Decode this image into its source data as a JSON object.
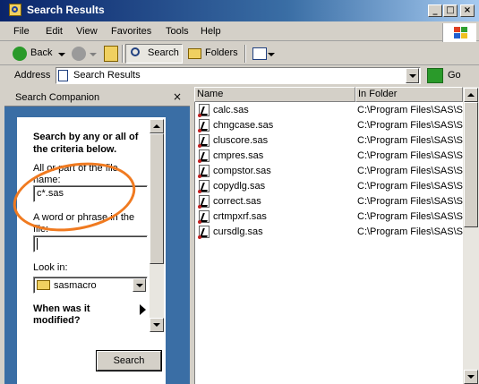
{
  "window": {
    "title": "Search Results",
    "controls": [
      "_",
      "□",
      "×"
    ]
  },
  "menubar": {
    "items": [
      "File",
      "Edit",
      "View",
      "Favorites",
      "Tools",
      "Help"
    ]
  },
  "toolbar": {
    "back_label": "Back",
    "search_label": "Search",
    "folders_label": "Folders"
  },
  "address_bar": {
    "label": "Address",
    "value": "Search Results",
    "go_label": "Go"
  },
  "search_companion": {
    "title": "Search Companion",
    "heading": "Search by any or all of the criteria below.",
    "filename_label": "All or part of the file name:",
    "filename_value": "c*.sas",
    "phrase_label": "A word or phrase in the file:",
    "phrase_value": "",
    "lookin_label": "Look in:",
    "lookin_value": "sasmacro",
    "modified_label": "When was it modified?",
    "search_button": "Search"
  },
  "results": {
    "columns": [
      "Name",
      "In Folder"
    ],
    "rows": [
      {
        "name": "calc.sas",
        "folder": "C:\\Program Files\\SAS\\SAS"
      },
      {
        "name": "chngcase.sas",
        "folder": "C:\\Program Files\\SAS\\SAS"
      },
      {
        "name": "cluscore.sas",
        "folder": "C:\\Program Files\\SAS\\SAS"
      },
      {
        "name": "cmpres.sas",
        "folder": "C:\\Program Files\\SAS\\SAS"
      },
      {
        "name": "compstor.sas",
        "folder": "C:\\Program Files\\SAS\\SAS"
      },
      {
        "name": "copydlg.sas",
        "folder": "C:\\Program Files\\SAS\\SAS"
      },
      {
        "name": "correct.sas",
        "folder": "C:\\Program Files\\SAS\\SAS"
      },
      {
        "name": "crtmpxrf.sas",
        "folder": "C:\\Program Files\\SAS\\SAS"
      },
      {
        "name": "cursdlg.sas",
        "folder": "C:\\Program Files\\SAS\\SAS"
      }
    ]
  },
  "colors": {
    "title_bar": "#0a246a",
    "panel_blue": "#3a6ea5",
    "annotation": "#f07a20"
  },
  "icons": [
    "search-window-icon",
    "back-arrow-icon",
    "forward-arrow-icon",
    "up-folder-icon",
    "search-icon",
    "folders-icon",
    "views-icon",
    "address-page-icon",
    "go-arrow-icon",
    "windows-logo-icon",
    "folder-icon",
    "expand-arrow-icon",
    "close-icon",
    "file-icon"
  ]
}
